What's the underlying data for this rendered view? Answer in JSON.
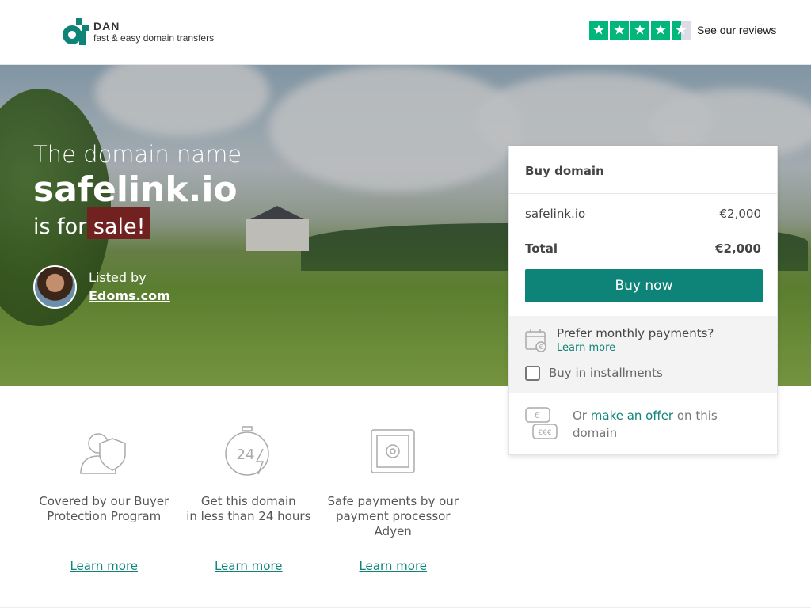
{
  "header": {
    "logo_name": "DAN",
    "logo_tagline": "fast & easy domain transfers",
    "reviews_label": "See our reviews",
    "rating_stars": 4.5,
    "brand_color": "#0e8478",
    "trustpilot_color": "#00b67a"
  },
  "hero": {
    "pre_title": "The domain name",
    "domain": "safelink.io",
    "post_title": "is for sale!",
    "listed_by_label": "Listed by",
    "seller_name": "Edoms.com"
  },
  "buy_card": {
    "title": "Buy domain",
    "item_name": "safelink.io",
    "item_price": "€2,000",
    "total_label": "Total",
    "total_price": "€2,000",
    "buy_button": "Buy now",
    "monthly_prompt": "Prefer monthly payments?",
    "monthly_learn_more": "Learn more",
    "installments_label": "Buy in installments",
    "installments_checked": false,
    "offer_prefix": "Or",
    "offer_link": "make an offer",
    "offer_suffix": "on this domain"
  },
  "features": [
    {
      "icon": "buyer-protection-icon",
      "text_line1": "Covered by our Buyer",
      "text_line2": "Protection Program",
      "text_line3": "",
      "link": "Learn more"
    },
    {
      "icon": "24-hour-clock-icon",
      "text_line1": "Get this domain",
      "text_line2": "in less than 24 hours",
      "text_line3": "",
      "link": "Learn more"
    },
    {
      "icon": "safe-icon",
      "text_line1": "Safe payments by our",
      "text_line2": "payment processor",
      "text_line3": "Adyen",
      "link": "Learn more"
    }
  ]
}
